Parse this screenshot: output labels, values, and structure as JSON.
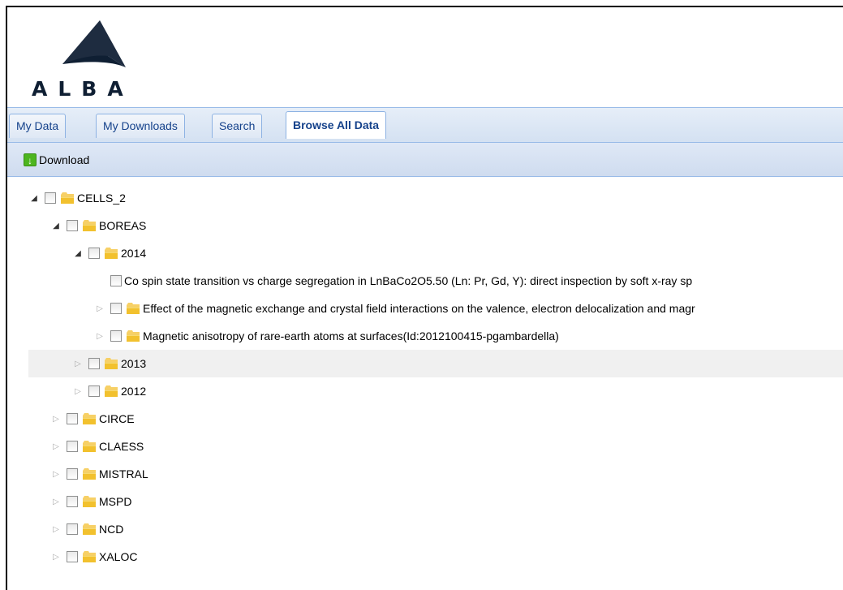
{
  "logo": {
    "text": "ALBA",
    "color": "#0f1f33"
  },
  "tabs": [
    {
      "label": "My Data",
      "active": false
    },
    {
      "label": "My Downloads",
      "active": false
    },
    {
      "label": "Search",
      "active": false
    },
    {
      "label": "Browse All Data",
      "active": true
    }
  ],
  "toolbar": {
    "download_label": "Download",
    "icon": "download-arrow-icon"
  },
  "tree": [
    {
      "label": "CELLS_2",
      "depth": 0,
      "state": "open",
      "folder": true
    },
    {
      "label": "BOREAS",
      "depth": 1,
      "state": "open",
      "folder": true
    },
    {
      "label": "2014",
      "depth": 2,
      "state": "open",
      "folder": true
    },
    {
      "label": "Co spin state transition vs charge segregation in LnBaCo2O5.50 (Ln: Pr, Gd, Y): direct inspection by soft x-ray sp",
      "depth": 3,
      "state": "leaf",
      "folder": false
    },
    {
      "label": "Effect of the magnetic exchange and crystal field interactions on the valence, electron delocalization and magr",
      "depth": 3,
      "state": "closed",
      "folder": true
    },
    {
      "label": "Magnetic anisotropy of rare-earth atoms at surfaces(Id:2012100415-pgambardella)",
      "depth": 3,
      "state": "closed",
      "folder": true
    },
    {
      "label": "2013",
      "depth": 2,
      "state": "closed",
      "folder": true,
      "highlight": true
    },
    {
      "label": "2012",
      "depth": 2,
      "state": "closed",
      "folder": true
    },
    {
      "label": "CIRCE",
      "depth": 1,
      "state": "closed",
      "folder": true
    },
    {
      "label": "CLAESS",
      "depth": 1,
      "state": "closed",
      "folder": true
    },
    {
      "label": "MISTRAL",
      "depth": 1,
      "state": "closed",
      "folder": true
    },
    {
      "label": "MSPD",
      "depth": 1,
      "state": "closed",
      "folder": true
    },
    {
      "label": "NCD",
      "depth": 1,
      "state": "closed",
      "folder": true
    },
    {
      "label": "XALOC",
      "depth": 1,
      "state": "closed",
      "folder": true
    }
  ],
  "colors": {
    "tab_text": "#15428b",
    "folder": "#f2c12e",
    "highlight": "#f0f0f0"
  }
}
